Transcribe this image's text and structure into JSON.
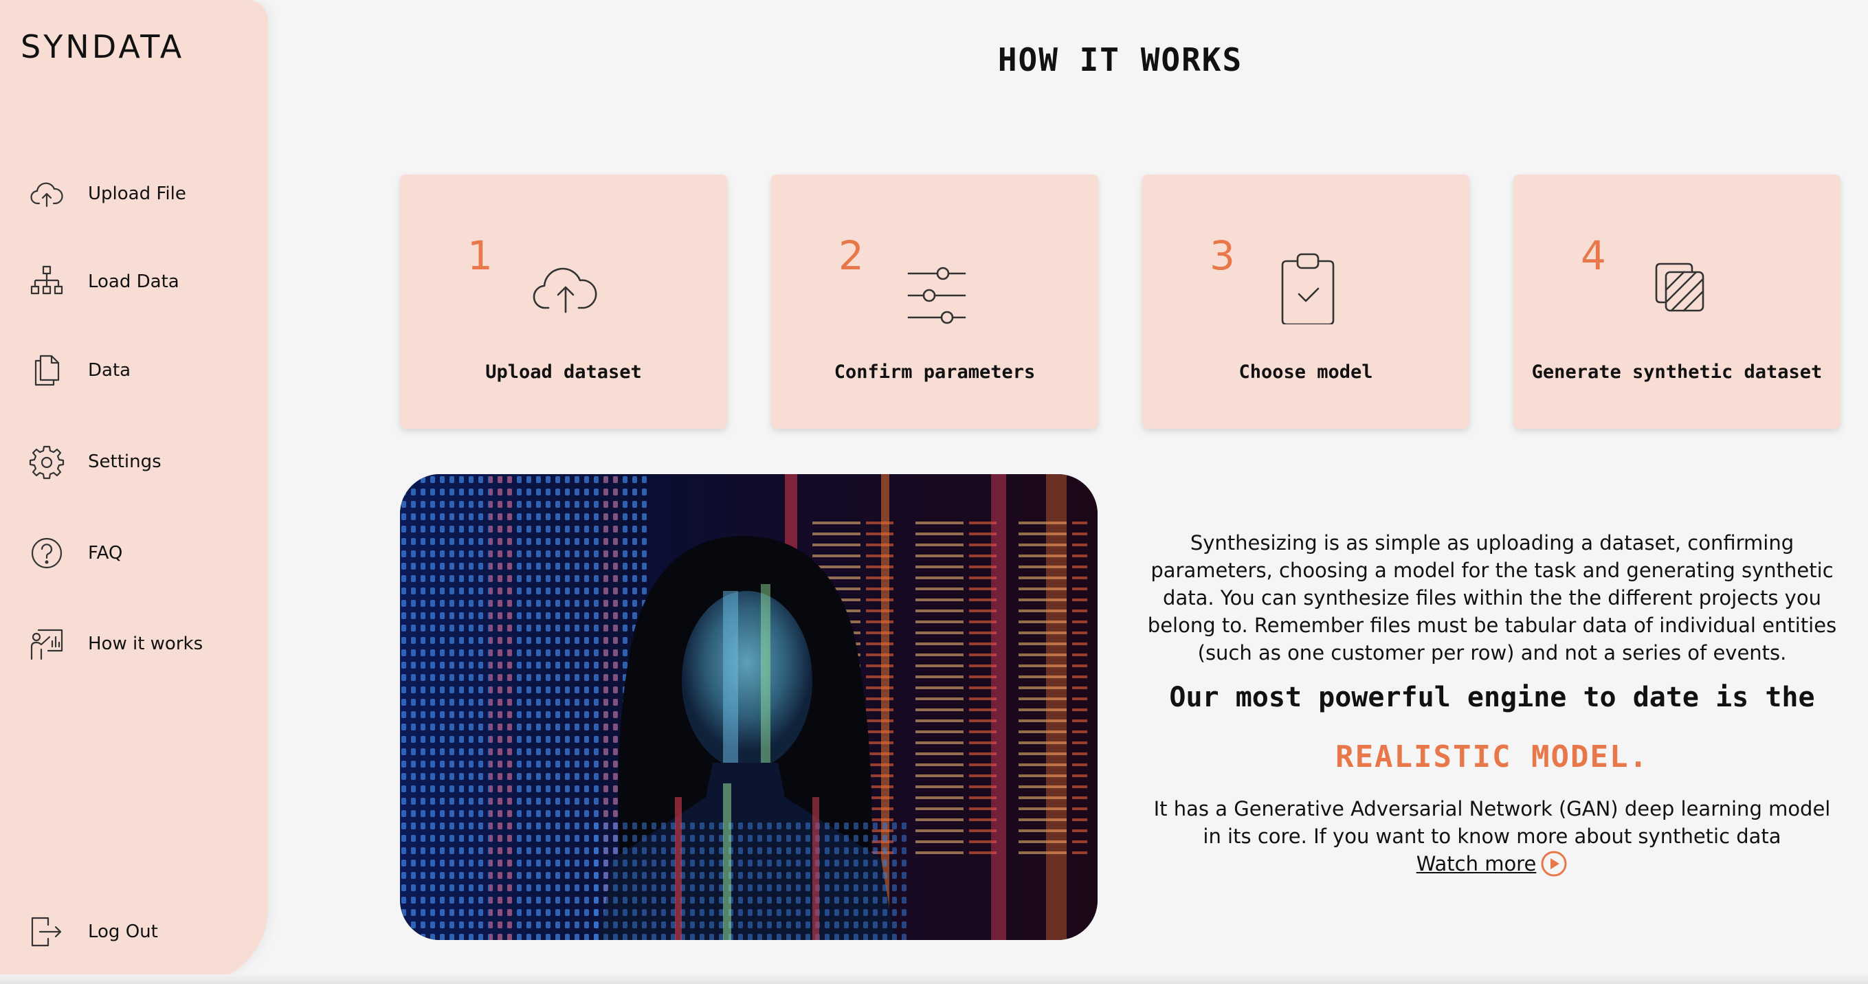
{
  "app": {
    "logo_text": "SYNDATA"
  },
  "sidebar": {
    "items": [
      {
        "label": "Upload File",
        "icon": "cloud-upload-icon"
      },
      {
        "label": "Load Data",
        "icon": "hierarchy-icon"
      },
      {
        "label": "Data",
        "icon": "documents-icon"
      },
      {
        "label": "Settings",
        "icon": "gear-icon"
      },
      {
        "label": "FAQ",
        "icon": "question-circle-icon"
      },
      {
        "label": "How it works",
        "icon": "presentation-icon"
      }
    ],
    "logout": {
      "label": "Log Out",
      "icon": "logout-icon"
    }
  },
  "main": {
    "title": "HOW IT WORKS",
    "steps": [
      {
        "number": "1",
        "label": "Upload dataset",
        "icon": "cloud-upload-icon"
      },
      {
        "number": "2",
        "label": "Confirm parameters",
        "icon": "sliders-icon"
      },
      {
        "number": "3",
        "label": "Choose model",
        "icon": "clipboard-check-icon"
      },
      {
        "number": "4",
        "label": "Generate synthetic dataset",
        "icon": "copy-layers-icon"
      }
    ],
    "description": "Synthesizing is as simple as uploading a dataset, confirming parameters, choosing a model for the task and generating synthetic data. You can synthesize files within the the different projects you belong to. Remember files must be tabular data of individual entities (such as one customer per row) and not a series of events.",
    "engine_line": "Our most powerful engine to date is the",
    "model_line": "REALISTIC MODEL.",
    "gan_text": "It has a Generative Adversarial Network (GAN) deep learning model in its core. If you want to know more about synthetic data",
    "watch_more": "Watch more"
  },
  "colors": {
    "accent": "#e8784a",
    "sidebar_bg": "#f7ddd4",
    "card_bg": "#f7ddd4",
    "page_bg": "#f5f5f5",
    "text": "#111111"
  }
}
